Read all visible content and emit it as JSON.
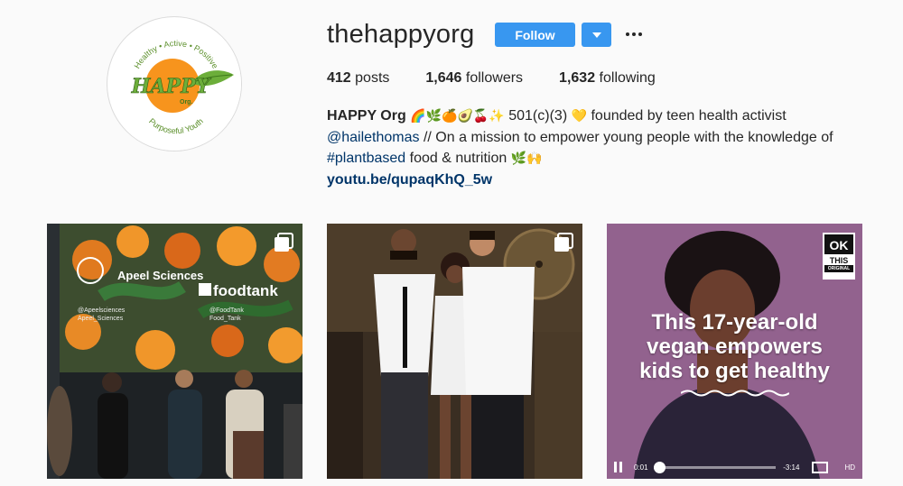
{
  "profile": {
    "avatar": {
      "arc_top": "Healthy • Active • Positive",
      "logo_text": "HAPPY",
      "org": "Org.",
      "arc_bottom": "Purposeful Youth"
    },
    "username": "thehappyorg",
    "follow_label": "Follow",
    "dropdown_icon": "chevron-down-icon",
    "more_icon": "ellipsis-icon"
  },
  "stats": {
    "posts_count": "412",
    "posts_label": "posts",
    "followers_count": "1,646",
    "followers_label": "followers",
    "following_count": "1,632",
    "following_label": "following"
  },
  "bio": {
    "name": "HAPPY Org",
    "emojis_1": "🌈🌿🍊🥑🍒✨",
    "line1_rest": "501(c)(3)",
    "heart_emoji": "💛",
    "line1_end": "founded by teen health activist",
    "mention": "@hailethomas",
    "line2_rest": "// On a mission to empower young people with the knowledge of",
    "hashtag": "#plantbased",
    "line3_rest": "food & nutrition",
    "emojis_2": "🌿🙌",
    "url": "youtu.be/qupaqKhQ_5w"
  },
  "posts": [
    {
      "type": "photo-carousel",
      "screen_text": {
        "brand1": "Apeel Sciences",
        "brand1_handle1": "@Apeelsciences",
        "brand1_handle2": "Apeel_Sciences",
        "brand2": "foodtank",
        "brand2_handle1": "@FoodTank",
        "brand2_handle2": "Food_Tank"
      },
      "icon": "carousel-icon"
    },
    {
      "type": "photo-carousel",
      "icon": "carousel-icon"
    },
    {
      "type": "video",
      "logo": {
        "top": "OK",
        "mid": "THIS",
        "bottom": "ORIGINAL"
      },
      "title": "This 17-year-old vegan empowers kids to get healthy",
      "title_l1": "This 17-year-old",
      "title_l2": "vegan empowers",
      "title_l3": "kids to get healthy",
      "elapsed": "0:01",
      "remaining": "-3:14",
      "hd_label": "HD"
    }
  ],
  "colors": {
    "accent": "#3897f0",
    "link": "#003569",
    "background": "#fafafa",
    "text": "#262626"
  }
}
